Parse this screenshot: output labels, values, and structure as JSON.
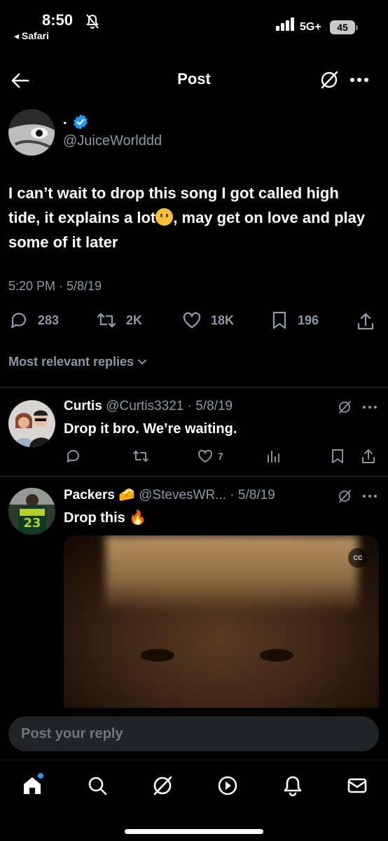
{
  "status_bar": {
    "time": "8:50",
    "back_app": "◂ Safari",
    "network": "5G+",
    "battery": "45"
  },
  "header": {
    "title": "Post",
    "icons": [
      "back-arrow-icon",
      "grok-icon",
      "more-icon"
    ]
  },
  "post": {
    "author_name": ".",
    "verified": true,
    "handle": "@JuiceWorlddd",
    "text_before_emoji": "I can’t wait to drop this song I got called high tide, it explains a lot",
    "text_after_emoji": ", may get on love and play some of it later",
    "emoji": "confused-face",
    "timestamp": "5:20 PM · 5/8/19",
    "stats": {
      "replies": "283",
      "reposts": "2K",
      "likes": "18K",
      "bookmarks": "196"
    },
    "replies_filter": "Most relevant replies"
  },
  "replies": [
    {
      "name": "Curtis",
      "handle": "@Curtis3321",
      "date": "· 5/8/19",
      "text": "Drop it bro. We’re waiting.",
      "likes": "7"
    },
    {
      "name": "Packers",
      "name_emoji": "🧀",
      "handle": "@StevesWR...",
      "date": "· 5/8/19",
      "text": "Drop this",
      "text_emoji": "🔥",
      "video_cc_label": "CC"
    }
  ],
  "composer": {
    "placeholder": "Post your reply"
  },
  "tabbar": {
    "items": [
      "home-icon",
      "search-icon",
      "grok-icon",
      "video-icon",
      "notifications-icon",
      "messages-icon"
    ],
    "accent": "#1d9bf0"
  },
  "colors": {
    "background": "#000000",
    "text": "#e7e9ea",
    "muted": "#8b98a5",
    "verified": "#1d9bf0"
  }
}
